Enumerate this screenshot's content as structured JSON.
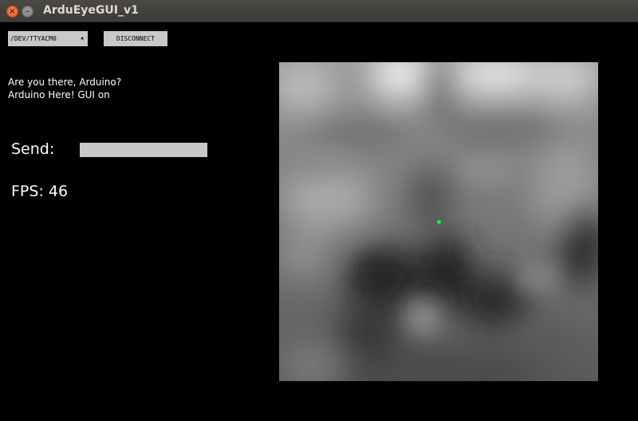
{
  "window": {
    "title": "ArduEyeGUI_v1",
    "close_glyph": "×",
    "minimize_glyph": "–"
  },
  "controls": {
    "port_selected": "/DEV/TTYACM0",
    "port_arrow_glyph": "▲",
    "disconnect_label": "DISCONNECT"
  },
  "log": {
    "lines": [
      "Are you there, Arduino?",
      "Arduino Here! GUI on"
    ]
  },
  "send": {
    "label": "Send:",
    "value": ""
  },
  "fps": {
    "label": "FPS: 46"
  },
  "camera": {
    "tracked_point_color": "#00ff2a"
  },
  "colors": {
    "background": "#000000",
    "control_gray": "#c8c8c8",
    "titlebar": "#3c3b37",
    "close_button": "#e25a1d"
  }
}
